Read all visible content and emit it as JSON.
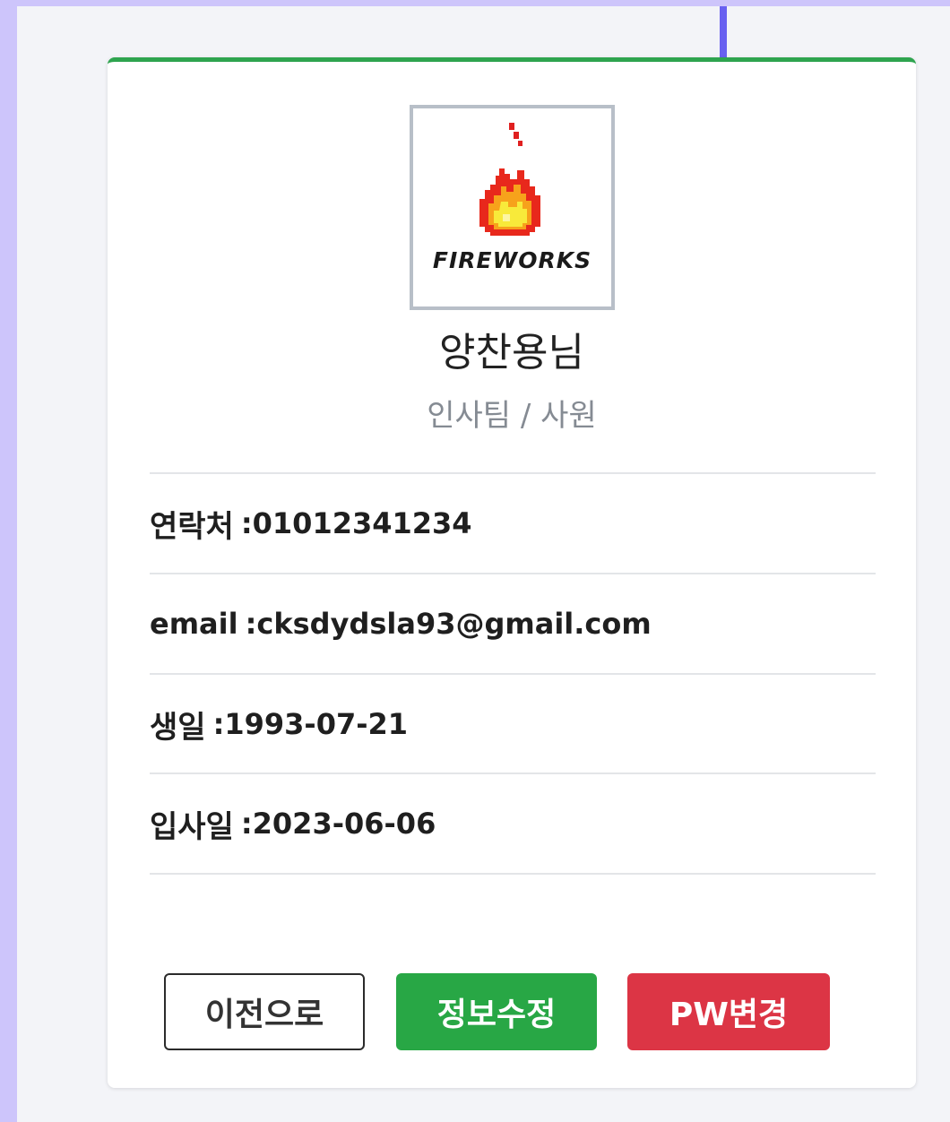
{
  "profile": {
    "logo_text": "FIREWORKS",
    "name": "양찬용님",
    "dept": "인사팀 / 사원"
  },
  "info": [
    {
      "label": "연락처",
      "sep": ":",
      "value": "01012341234"
    },
    {
      "label": "email",
      "sep": ":",
      "value": "cksdydsla93@gmail.com"
    },
    {
      "label": "생일",
      "sep": ":",
      "value": "1993-07-21"
    },
    {
      "label": "입사일",
      "sep": ":",
      "value": "2023-06-06"
    }
  ],
  "buttons": {
    "back": "이전으로",
    "edit": "정보수정",
    "pw": "PW변경"
  },
  "colors": {
    "card_top_border": "#2ea44f",
    "edit_button": "#28a745",
    "pw_button": "#dc3545",
    "outer_bg": "#cdc5fb",
    "accent_line": "#6860f0"
  },
  "icons": {
    "logo": "fire-icon"
  }
}
